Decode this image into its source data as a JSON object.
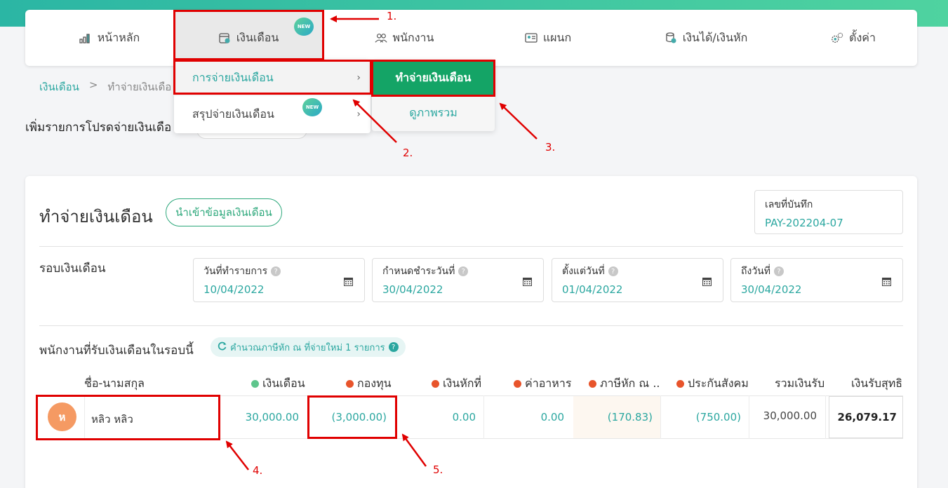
{
  "nav": {
    "items": [
      {
        "label": "หน้าหลัก",
        "icon": "bar-chart-icon"
      },
      {
        "label": "เงินเดือน",
        "icon": "payroll-calendar-icon",
        "badge": "NEW"
      },
      {
        "label": "พนักงาน",
        "icon": "people-icon"
      },
      {
        "label": "แผนก",
        "icon": "id-card-icon"
      },
      {
        "label": "เงินได้/เงินหัก",
        "icon": "coins-icon"
      },
      {
        "label": "ตั้งค่า",
        "icon": "gears-icon"
      }
    ]
  },
  "breadcrumb": {
    "root": "เงินเดือน",
    "separator": ">",
    "current": "ทำจ่ายเงินเดือ"
  },
  "add_title": "เพิ่มรายการโปรดจ่ายเงินเดือ",
  "submenu": {
    "items": [
      {
        "label": "การจ่ายเงินเดือน",
        "chevron": "›"
      },
      {
        "label": "สรุปจ่ายเงินเดือน",
        "chevron": "›",
        "badge": "NEW"
      }
    ],
    "sub_items": [
      "ทำจ่ายเงินเดือน",
      "ดูภาพรวม"
    ]
  },
  "card": {
    "title": "ทำจ่ายเงินเดือน",
    "import_button": "นำเข้าข้อมูลเงินเดือน",
    "record": {
      "label": "เลขที่บันทึก",
      "value": "PAY-202204-07"
    },
    "round_label": "รอบเงินเดือน",
    "dates": [
      {
        "label": "วันที่ทำรายการ",
        "value": "10/04/2022"
      },
      {
        "label": "กำหนดชำระวันที่",
        "value": "30/04/2022"
      },
      {
        "label": "ตั้งแต่วันที่",
        "value": "01/04/2022"
      },
      {
        "label": "ถึงวันที่",
        "value": "30/04/2022"
      }
    ],
    "help_glyph": "?",
    "employees_title": "พนักงานที่รับเงินเดือนในรอบนี้",
    "tax_pill": "คำนวณภาษีหัก ณ ที่จ่ายใหม่ 1 รายการ"
  },
  "table": {
    "headers": [
      "ชื่อ-นามสกุล",
      "เงินเดือน",
      "กองทุน",
      "เงินหักที่",
      "ค่าอาหาร",
      "ภาษีหัก ณ ..",
      "ประกันสังคม",
      "รวมเงินรับ",
      "เงินรับสุทธิ"
    ],
    "row": {
      "avatar": "ห",
      "name": "หลิว หลิว",
      "salary": "30,000.00",
      "fund": "(3,000.00)",
      "deduction": "0.00",
      "food": "0.00",
      "tax": "(170.83)",
      "social": "(750.00)",
      "total": "30,000.00",
      "net": "26,079.17"
    }
  },
  "annotations": [
    "1.",
    "2.",
    "3.",
    "4.",
    "5."
  ],
  "colors": {
    "accent": "#2ba7a0",
    "green": "#14a466",
    "red_dot": "#e8542b",
    "green_dot": "#5ec58c",
    "annotation": "#e00000"
  }
}
